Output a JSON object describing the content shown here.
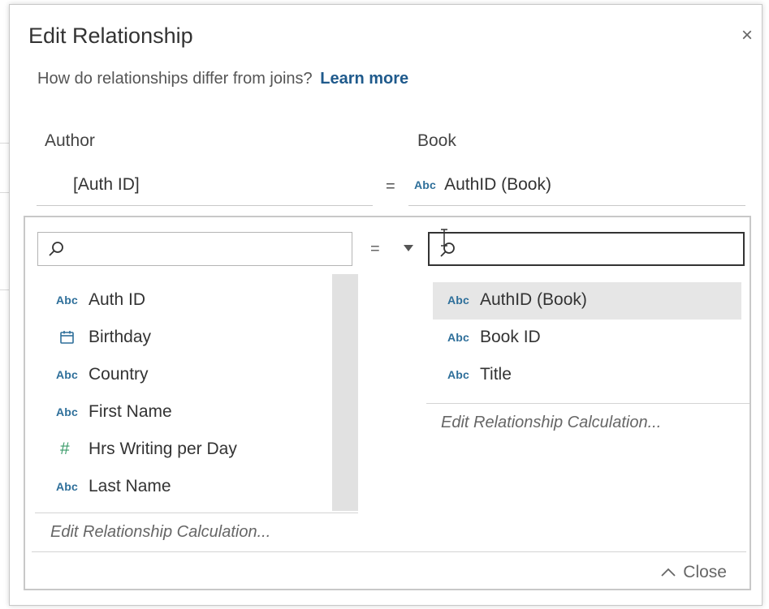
{
  "dialog": {
    "title": "Edit Relationship",
    "close_icon": "close-icon",
    "subtitle": "How do relationships differ from joins?",
    "learn_more": "Learn more"
  },
  "relationship": {
    "left_table": "Author",
    "right_table": "Book",
    "left_field": "[Auth ID]",
    "operator": "=",
    "right_field_type": "Abc",
    "right_field": "AuthID (Book)"
  },
  "editor": {
    "left_search_placeholder": "",
    "right_search_placeholder": "",
    "operator": "=",
    "left_fields": [
      {
        "type": "Abc",
        "icon": "string-type-icon",
        "label": "Auth ID"
      },
      {
        "type": "",
        "icon": "date-type-icon",
        "label": "Birthday"
      },
      {
        "type": "Abc",
        "icon": "string-type-icon",
        "label": "Country"
      },
      {
        "type": "Abc",
        "icon": "string-type-icon",
        "label": "First Name"
      },
      {
        "type": "#",
        "icon": "number-type-icon",
        "label": "Hrs Writing per Day"
      },
      {
        "type": "Abc",
        "icon": "string-type-icon",
        "label": "Last Name"
      }
    ],
    "right_fields": [
      {
        "type": "Abc",
        "icon": "string-type-icon",
        "label": "AuthID (Book)",
        "selected": true
      },
      {
        "type": "Abc",
        "icon": "string-type-icon",
        "label": "Book ID"
      },
      {
        "type": "Abc",
        "icon": "string-type-icon",
        "label": "Title"
      }
    ],
    "left_edit_calc": "Edit Relationship Calculation...",
    "right_edit_calc": "Edit Relationship Calculation...",
    "close_label": "Close"
  },
  "colors": {
    "accent_link": "#1f5a8c",
    "type_blue": "#2e6f9a",
    "number_green": "#3b9b6a",
    "selected_row": "#e6e6e6"
  }
}
